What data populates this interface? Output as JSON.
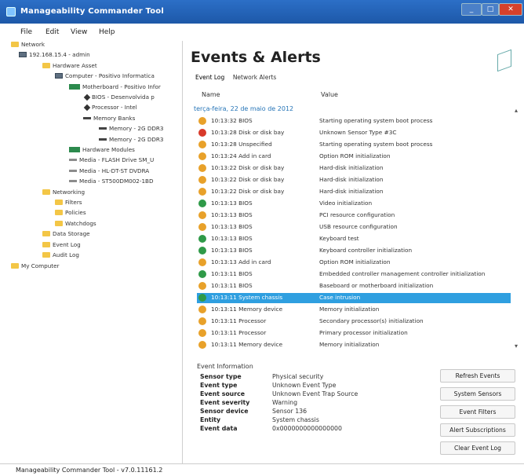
{
  "window": {
    "title": "Manageability Commander Tool"
  },
  "menu": [
    "File",
    "Edit",
    "View",
    "Help"
  ],
  "tree": [
    {
      "label": "Network",
      "level": 0,
      "icon": "folder-icon"
    },
    {
      "label": "192.168.15.4 - admin",
      "level": 1,
      "icon": "computer-icon"
    },
    {
      "label": "Hardware Asset",
      "level": 2,
      "icon": "folder-icon"
    },
    {
      "label": "Computer - Positivo Informatica",
      "level": 3,
      "icon": "computer-icon"
    },
    {
      "label": "Motherboard - Positivo Infor",
      "level": 4,
      "icon": "motherboard-icon"
    },
    {
      "label": "BIOS - Desenvolvida p",
      "level": 5,
      "icon": "chip-icon"
    },
    {
      "label": "Processor - Intel",
      "level": 5,
      "icon": "chip-icon"
    },
    {
      "label": "Memory Banks",
      "level": 5,
      "icon": "memory-icon"
    },
    {
      "label": "Memory - 2G DDR3",
      "level": 6,
      "icon": "memory-icon"
    },
    {
      "label": "Memory - 2G DDR3",
      "level": 6,
      "icon": "memory-icon"
    },
    {
      "label": "Hardware Modules",
      "level": 4,
      "icon": "motherboard-icon"
    },
    {
      "label": "Media - FLASH Drive SM_U",
      "level": 4,
      "icon": "drive-icon"
    },
    {
      "label": "Media - HL-DT-ST DVDRA",
      "level": 4,
      "icon": "drive-icon"
    },
    {
      "label": "Media - ST500DM002-1BD",
      "level": 4,
      "icon": "drive-icon"
    },
    {
      "label": "Networking",
      "level": 2,
      "icon": "folder-icon"
    },
    {
      "label": "Filters",
      "level": 3,
      "icon": "folder-icon"
    },
    {
      "label": "Policies",
      "level": 3,
      "icon": "folder-icon"
    },
    {
      "label": "Watchdogs",
      "level": 3,
      "icon": "folder-icon"
    },
    {
      "label": "Data Storage",
      "level": 2,
      "icon": "folder-icon"
    },
    {
      "label": "Event Log",
      "level": 2,
      "icon": "folder-icon"
    },
    {
      "label": "Audit Log",
      "level": 2,
      "icon": "folder-icon"
    },
    {
      "label": "My Computer",
      "level": 0,
      "icon": "folder-icon"
    }
  ],
  "status": "Manageability Commander Tool - v7.0.11161.2",
  "panel": {
    "heading": "Events & Alerts",
    "tabs": [
      "Event Log",
      "Network Alerts"
    ],
    "columns": {
      "name": "Name",
      "value": "Value"
    },
    "date_group": "terça-feira, 22 de maio de 2012",
    "events": [
      {
        "name": "10:13:32 BIOS",
        "value": "Starting operating system boot process",
        "severity": "orange"
      },
      {
        "name": "10:13:28 Disk or disk bay",
        "value": "Unknown Sensor Type #3C",
        "severity": "red"
      },
      {
        "name": "10:13:28 Unspecified",
        "value": "Starting operating system boot process",
        "severity": "orange"
      },
      {
        "name": "10:13:24 Add in card",
        "value": "Option ROM initialization",
        "severity": "orange"
      },
      {
        "name": "10:13:22 Disk or disk bay",
        "value": "Hard-disk initialization",
        "severity": "orange"
      },
      {
        "name": "10:13:22 Disk or disk bay",
        "value": "Hard-disk initialization",
        "severity": "orange"
      },
      {
        "name": "10:13:22 Disk or disk bay",
        "value": "Hard-disk initialization",
        "severity": "orange"
      },
      {
        "name": "10:13:13 BIOS",
        "value": "Video initialization",
        "severity": "green"
      },
      {
        "name": "10:13:13 BIOS",
        "value": "PCI resource configuration",
        "severity": "orange"
      },
      {
        "name": "10:13:13 BIOS",
        "value": "USB resource configuration",
        "severity": "orange"
      },
      {
        "name": "10:13:13 BIOS",
        "value": "Keyboard test",
        "severity": "green"
      },
      {
        "name": "10:13:13 BIOS",
        "value": "Keyboard controller initialization",
        "severity": "green"
      },
      {
        "name": "10:13:13 Add in card",
        "value": "Option ROM initialization",
        "severity": "orange"
      },
      {
        "name": "10:13:11 BIOS",
        "value": "Embedded controller management controller initialization",
        "severity": "green"
      },
      {
        "name": "10:13:11 BIOS",
        "value": "Baseboard or motherboard initialization",
        "severity": "orange"
      },
      {
        "name": "10:13:11 System chassis",
        "value": "Case intrusion",
        "severity": "green",
        "selected": true
      },
      {
        "name": "10:13:11 Memory device",
        "value": "Memory initialization",
        "severity": "orange"
      },
      {
        "name": "10:13:11 Processor",
        "value": "Secondary processor(s) initialization",
        "severity": "orange"
      },
      {
        "name": "10:13:11 Processor",
        "value": "Primary processor initialization",
        "severity": "orange"
      },
      {
        "name": "10:13:11 Memory device",
        "value": "Memory initialization",
        "severity": "orange"
      }
    ],
    "info": {
      "title": "Event Information",
      "rows": [
        {
          "key": "Sensor type",
          "value": "Physical security"
        },
        {
          "key": "Event type",
          "value": "Unknown Event Type"
        },
        {
          "key": "Event source",
          "value": "Unknown Event Trap Source"
        },
        {
          "key": "Event severity",
          "value": "Warning"
        },
        {
          "key": "Sensor device",
          "value": "Sensor 136"
        },
        {
          "key": "Entity",
          "value": "System chassis"
        },
        {
          "key": "Event data",
          "value": "0x0000000000000000"
        }
      ]
    },
    "buttons": [
      "Refresh Events",
      "System Sensors",
      "Event Filters",
      "Alert Subscriptions",
      "Clear Event Log"
    ]
  },
  "colors": {
    "orange": "#e8a12a",
    "red": "#d83a2a",
    "green": "#2f9a48",
    "selection": "#2f9fe0",
    "titlebar": "#2266bb"
  }
}
